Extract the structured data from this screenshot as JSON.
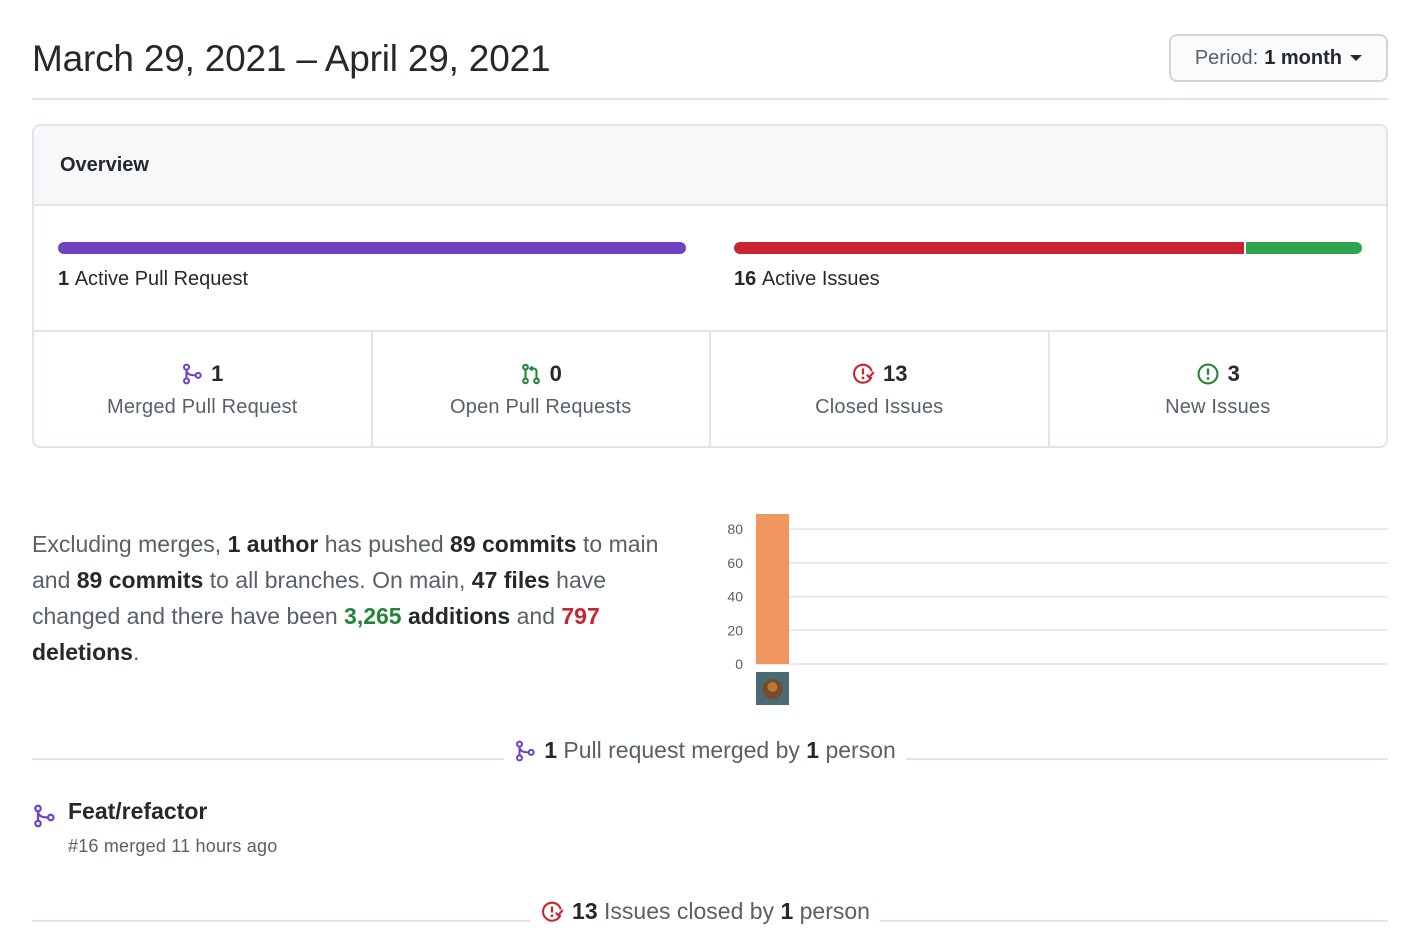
{
  "header": {
    "date_range": "March 29, 2021 – April 29, 2021",
    "period_prefix": "Period:",
    "period_value": "1 month"
  },
  "overview": {
    "title": "Overview",
    "active_prs_count": "1",
    "active_prs_label": "Active Pull Request",
    "active_issues_count": "16",
    "active_issues_label": "Active Issues",
    "issues_closed_fraction": 0.8125,
    "stats": [
      {
        "count": "1",
        "label": "Merged Pull Request",
        "icon": "git-merge-icon"
      },
      {
        "count": "0",
        "label": "Open Pull Requests",
        "icon": "git-pull-request-icon"
      },
      {
        "count": "13",
        "label": "Closed Issues",
        "icon": "issue-closed-icon"
      },
      {
        "count": "3",
        "label": "New Issues",
        "icon": "issue-opened-icon"
      }
    ]
  },
  "summary": {
    "t1": "Excluding merges, ",
    "authors": "1 author",
    "t2": " has pushed ",
    "commits_main": "89 commits",
    "t3": " to main and ",
    "commits_all": "89 commits",
    "t4": " to all branches. On main, ",
    "files": "47 files",
    "t5": " have changed and there have been ",
    "additions_num": "3,265",
    "additions_word": " additions",
    "t6": " and ",
    "deletions_num": "797",
    "deletions_word": " deletions",
    "t7": "."
  },
  "chart_data": {
    "type": "bar",
    "categories": [
      "author"
    ],
    "values": [
      89
    ],
    "ylim": [
      0,
      89
    ],
    "yticks": [
      "80",
      "60",
      "40",
      "20",
      "0"
    ],
    "bar_color": "#f0975f",
    "grid": true
  },
  "prs_section": {
    "count": "1",
    "text1": " Pull request merged by ",
    "people": "1",
    "text2": " person"
  },
  "pr_item": {
    "title": "Feat/refactor",
    "meta": "#16 merged 11 hours ago"
  },
  "issues_section": {
    "count": "13",
    "text1": " Issues closed by ",
    "people": "1",
    "text2": " person"
  },
  "colors": {
    "purple": "#6f42c1",
    "red": "#cb2431",
    "green": "#2ea44f"
  }
}
